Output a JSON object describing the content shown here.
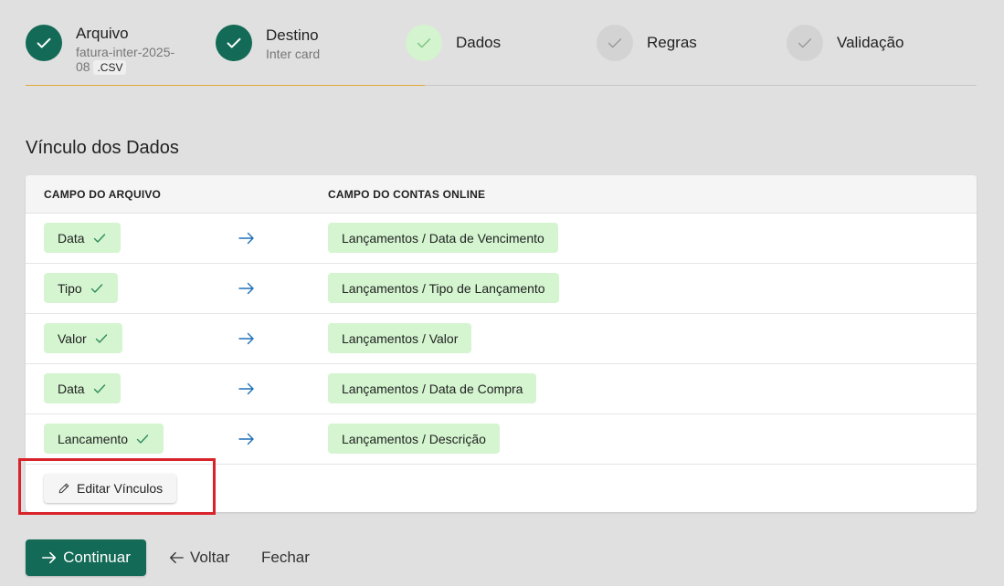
{
  "stepper": {
    "steps": [
      {
        "title": "Arquivo",
        "subtitle_line1": "fatura-inter-2025-",
        "subtitle_line2": "08",
        "file_ext": ".CSV",
        "state": "done"
      },
      {
        "title": "Destino",
        "subtitle": "Inter card",
        "state": "done"
      },
      {
        "title": "Dados",
        "state": "current"
      },
      {
        "title": "Regras",
        "state": "pending"
      },
      {
        "title": "Validação",
        "state": "pending"
      }
    ],
    "progress_percent": 42
  },
  "section": {
    "title": "Vínculo dos Dados"
  },
  "table": {
    "headers": {
      "file_field": "CAMPO DO ARQUIVO",
      "app_field": "CAMPO DO CONTAS ONLINE"
    },
    "rows": [
      {
        "source": "Data",
        "target": "Lançamentos / Data de Vencimento"
      },
      {
        "source": "Tipo",
        "target": "Lançamentos / Tipo de Lançamento"
      },
      {
        "source": "Valor",
        "target": "Lançamentos / Valor"
      },
      {
        "source": "Data",
        "target": "Lançamentos / Data de Compra"
      },
      {
        "source": "Lancamento",
        "target": "Lançamentos / Descrição"
      }
    ],
    "edit_button_label": "Editar Vínculos"
  },
  "footer": {
    "continue_label": "Continuar",
    "back_label": "Voltar",
    "close_label": "Fechar"
  },
  "colors": {
    "primary": "#136a56",
    "chip_bg": "#d4f5d0",
    "progress": "#e0a93a",
    "highlight": "#d8232a",
    "arrow": "#1d6fb8"
  },
  "icons": {
    "step_done": "check-icon",
    "mapping": "arrow-right-icon",
    "edit": "pencil-icon",
    "back": "arrow-left-icon"
  }
}
